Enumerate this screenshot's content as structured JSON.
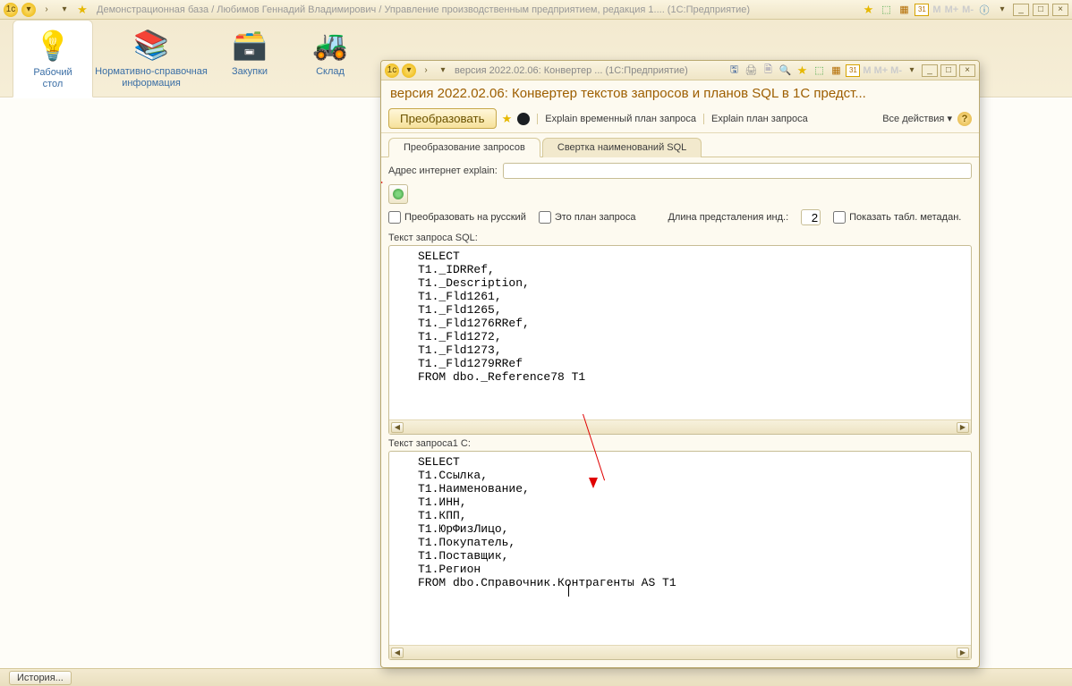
{
  "outer": {
    "title": "Демонстрационная база / Любимов Геннадий Владимирович / Управление производственным предприятием, редакция 1....   (1С:Предприятие)",
    "star": "★",
    "m": "M",
    "mplus": "M+",
    "mminus": "M-",
    "min": "_",
    "max": "□",
    "close": "×",
    "cal31": "31"
  },
  "toolbar": {
    "items": [
      {
        "label": "Рабочий\nстол",
        "icon": "💡",
        "color": "#3a89e0"
      },
      {
        "label": "Нормативно-справочная\nинформация",
        "icon": "📚",
        "color": "#7bb43a"
      },
      {
        "label": "Закупки",
        "icon": "🗃️",
        "color": "#d9893a"
      },
      {
        "label": "Склад",
        "icon": "🚜",
        "color": "#d9a43a"
      }
    ]
  },
  "statusbar": {
    "history": "История..."
  },
  "inner": {
    "title_short": "версия 2022.02.06: Конвертер ...   (1С:Предприятие)",
    "title_full": "версия 2022.02.06: Конвертер текстов запросов и планов SQL в 1С предст...",
    "cmd": {
      "convert": "Преобразовать",
      "explain_tmp": "Explain временный план запроса",
      "explain_plan": "Explain план запроса",
      "all_actions": "Все действия",
      "dd": "▾",
      "help": "?"
    },
    "tabs": {
      "convert": "Преобразование запросов",
      "collapse": "Свертка наименований SQL"
    },
    "form": {
      "addr_label": "Адрес интернет explain:",
      "addr_value": "",
      "chk_rus": "Преобразовать на русский",
      "chk_plan": "Это план запроса",
      "len_label": "Длина предсталения инд.:",
      "len_value": "2",
      "chk_meta": "Показать табл. метадан.",
      "lbl_sql": "Текст запроса SQL:",
      "lbl_1c": "Текст запроса1 С:"
    },
    "sql_text": "SELECT\nT1._IDRRef,\nT1._Description,\nT1._Fld1261,\nT1._Fld1265,\nT1._Fld1276RRef,\nT1._Fld1272,\nT1._Fld1273,\nT1._Fld1279RRef\nFROM dbo._Reference78 T1",
    "result_text": "SELECT\nT1.Ссылка,\nT1.Наименование,\nT1.ИНН,\nT1.КПП,\nT1.ЮрФизЛицо,\nT1.Покупатель,\nT1.Поставщик,\nT1.Регион\nFROM dbo.Справочник.Контрагенты AS T1",
    "scroll_left": "◀",
    "scroll_right": "▶"
  }
}
